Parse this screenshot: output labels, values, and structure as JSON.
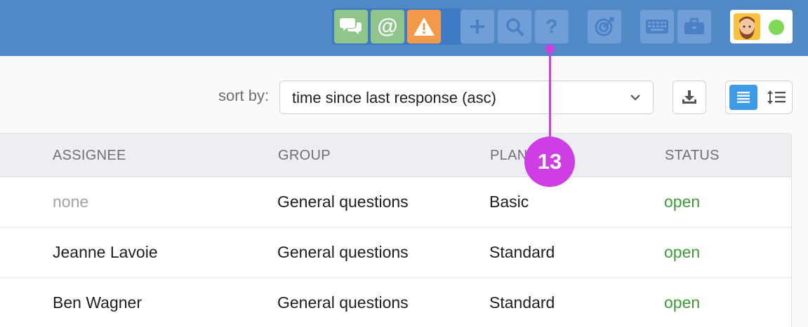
{
  "topbar": {
    "buttons": [
      {
        "name": "chats-icon",
        "color": "#8fc48b"
      },
      {
        "name": "mentions-icon",
        "color": "#8fc48b"
      },
      {
        "name": "alert-icon",
        "color": "#f2994a"
      },
      {
        "name": "plus-icon",
        "color": "#6f9fd6"
      },
      {
        "name": "search-icon",
        "color": "#6f9fd6"
      },
      {
        "name": "help-icon",
        "color": "#6f9fd6"
      },
      {
        "name": "target-icon",
        "color": "#6f9fd6"
      },
      {
        "name": "keyboard-icon",
        "color": "#6f9fd6"
      },
      {
        "name": "briefcase-icon",
        "color": "#6f9fd6"
      }
    ],
    "status_color": "#7ed957"
  },
  "toolbar": {
    "sort_label": "sort by:",
    "sort_value": "time since last response (asc)"
  },
  "table": {
    "columns": [
      "ASSIGNEE",
      "GROUP",
      "PLAN",
      "STATUS"
    ],
    "rows": [
      {
        "assignee": "none",
        "group": "General questions",
        "plan": "Basic",
        "status": "open"
      },
      {
        "assignee": "Jeanne Lavoie",
        "group": "General questions",
        "plan": "Standard",
        "status": "open"
      },
      {
        "assignee": "Ben Wagner",
        "group": "General questions",
        "plan": "Standard",
        "status": "open"
      }
    ]
  },
  "annotation": {
    "number": "13",
    "color": "#cf3ee4"
  }
}
